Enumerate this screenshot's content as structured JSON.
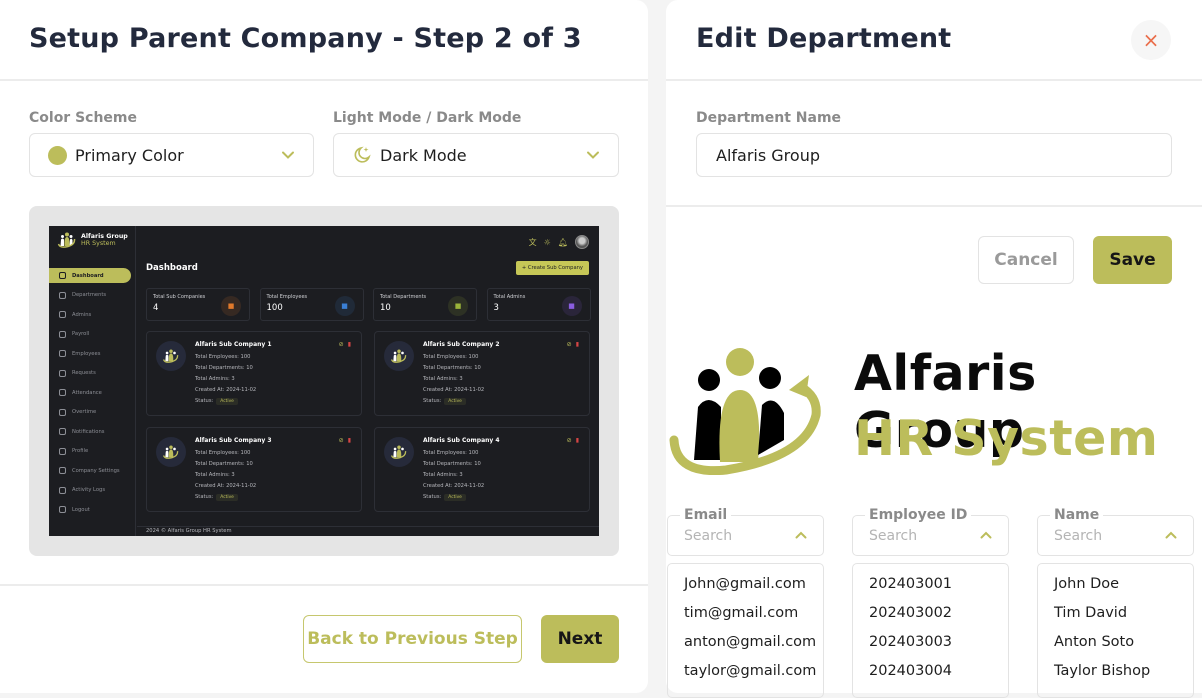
{
  "setup": {
    "title": "Setup Parent Company - Step 2 of 3",
    "color_scheme": {
      "label": "Color Scheme",
      "value": "Primary Color",
      "swatch": "#bcbd5b"
    },
    "mode": {
      "label": "Light Mode / Dark Mode",
      "value": "Dark Mode",
      "icon": "moon-stars-icon"
    },
    "preview": {
      "brand": {
        "line1": "Alfaris Group",
        "line2": "HR System"
      },
      "nav": [
        {
          "label": "Dashboard",
          "icon": "grid-icon",
          "active": true
        },
        {
          "label": "Departments",
          "icon": "branch-icon"
        },
        {
          "label": "Admins",
          "icon": "admin-icon"
        },
        {
          "label": "Payroll",
          "icon": "money-icon"
        },
        {
          "label": "Employees",
          "icon": "employee-icon"
        },
        {
          "label": "Requests",
          "icon": "request-icon"
        },
        {
          "label": "Attendance",
          "icon": "calendar-icon"
        },
        {
          "label": "Overtime",
          "icon": "clock-icon"
        },
        {
          "label": "Notifications",
          "icon": "bell-icon"
        },
        {
          "label": "Profile",
          "icon": "user-icon"
        },
        {
          "label": "Company Settings",
          "icon": "gear-icon"
        },
        {
          "label": "Activity Logs",
          "icon": "log-icon"
        },
        {
          "label": "Logout",
          "icon": "logout-icon"
        }
      ],
      "page_title": "Dashboard",
      "create_button": "+ Create Sub Company",
      "stats": [
        {
          "label": "Total Sub Companies",
          "value": "4",
          "color": "#e0792b"
        },
        {
          "label": "Total Employees",
          "value": "100",
          "color": "#3a7fd5"
        },
        {
          "label": "Total Departments",
          "value": "10",
          "color": "#9ab43a"
        },
        {
          "label": "Total Admins",
          "value": "3",
          "color": "#8a5de0"
        }
      ],
      "companies": [
        {
          "name": "Alfaris Sub Company 1",
          "employees": "Total Employees: 100",
          "departments": "Total Departments: 10",
          "admins": "Total Admins: 3",
          "created": "Created At: 2024-11-02",
          "status_label": "Status:",
          "status": "Active"
        },
        {
          "name": "Alfaris Sub Company 2",
          "employees": "Total Employees: 100",
          "departments": "Total Departments: 10",
          "admins": "Total Admins: 3",
          "created": "Created At: 2024-11-02",
          "status_label": "Status:",
          "status": "Active"
        },
        {
          "name": "Alfaris Sub Company 3",
          "employees": "Total Employees: 100",
          "departments": "Total Departments: 10",
          "admins": "Total Admins: 3",
          "created": "Created At: 2024-11-02",
          "status_label": "Status:",
          "status": "Active"
        },
        {
          "name": "Alfaris Sub Company 4",
          "employees": "Total Employees: 100",
          "departments": "Total Departments: 10",
          "admins": "Total Admins: 3",
          "created": "Created At: 2024-11-02",
          "status_label": "Status:",
          "status": "Active"
        }
      ],
      "footer": "2024 © Alfaris Group HR System"
    },
    "back_button": "Back to Previous Step",
    "next_button": "Next"
  },
  "edit": {
    "title": "Edit Department",
    "close_icon": "×",
    "field_label": "Department Name",
    "field_value": "Alfaris Group",
    "cancel_button": "Cancel",
    "save_button": "Save",
    "brand": {
      "line1": "Alfaris Group",
      "line2": "HR System"
    },
    "filters": [
      {
        "label": "Email",
        "placeholder": "Search",
        "items": [
          "John@gmail.com",
          "tim@gmail.com",
          "anton@gmail.com",
          "taylor@gmail.com"
        ]
      },
      {
        "label": "Employee ID",
        "placeholder": "Search",
        "items": [
          "202403001",
          "202403002",
          "202403003",
          "202403004"
        ]
      },
      {
        "label": "Name",
        "placeholder": "Search",
        "items": [
          "John Doe",
          "Tim David",
          "Anton Soto",
          "Taylor Bishop"
        ]
      }
    ]
  },
  "colors": {
    "primary": "#bcbd5b",
    "dark": "#232a3d",
    "close": "#ea6d4a"
  }
}
